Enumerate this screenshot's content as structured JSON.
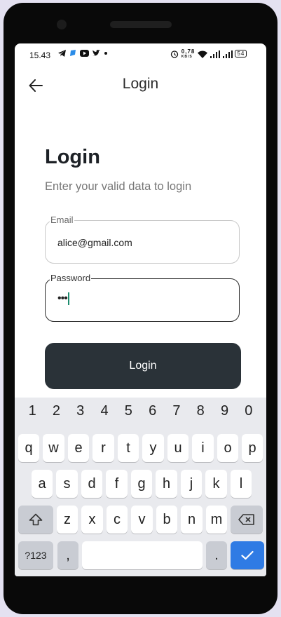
{
  "status_bar": {
    "time": "15.43",
    "left_icons": [
      "telegram-icon",
      "chat-bubble-icon",
      "youtube-icon",
      "twitter-icon",
      "dot-icon"
    ],
    "network_speed": "0,78",
    "network_unit": "KB/S",
    "battery": "54"
  },
  "app_bar": {
    "title": "Login"
  },
  "content": {
    "heading": "Login",
    "subheading": "Enter your valid data to login"
  },
  "email_field": {
    "label": "Email",
    "value": "alice@gmail.com"
  },
  "password_field": {
    "label": "Password",
    "value": "•••"
  },
  "login_button": {
    "label": "Login"
  },
  "keyboard": {
    "number_row": [
      "1",
      "2",
      "3",
      "4",
      "5",
      "6",
      "7",
      "8",
      "9",
      "0"
    ],
    "row1": [
      "q",
      "w",
      "e",
      "r",
      "t",
      "y",
      "u",
      "i",
      "o",
      "p"
    ],
    "row2": [
      "a",
      "s",
      "d",
      "f",
      "g",
      "h",
      "j",
      "k",
      "l"
    ],
    "row3": [
      "z",
      "x",
      "c",
      "v",
      "b",
      "n",
      "m"
    ],
    "symbols_key": "?123",
    "comma_key": ",",
    "period_key": ".",
    "accent_color": "#2f7be4"
  }
}
